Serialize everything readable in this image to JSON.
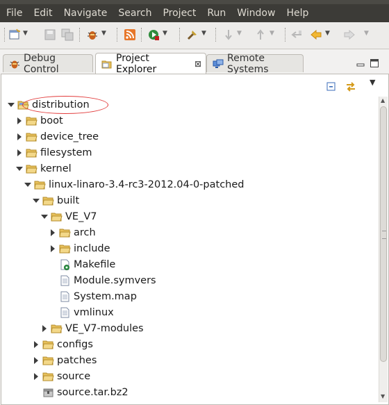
{
  "menu": [
    "File",
    "Edit",
    "Navigate",
    "Search",
    "Project",
    "Run",
    "Window",
    "Help"
  ],
  "toolbar": {
    "icons": [
      "new-icon",
      "save-icon",
      "save-all-icon",
      "debug-icon",
      "rss-icon",
      "run-icon",
      "external-tool-icon",
      "next-edit-icon",
      "previous-edit-icon",
      "last-edit-icon",
      "back-icon",
      "forward-icon"
    ]
  },
  "tabs": [
    {
      "label": "Debug Control",
      "icon": "bug-icon",
      "active": false
    },
    {
      "label": "Project Explorer",
      "icon": "folder-icon",
      "active": true,
      "close": "⊠"
    },
    {
      "label": "Remote Systems",
      "icon": "remote-systems-icon",
      "active": false
    }
  ],
  "tree": [
    {
      "label": "distribution",
      "depth": 0,
      "state": "expanded",
      "type": "project"
    },
    {
      "label": "boot",
      "depth": 1,
      "state": "collapsed",
      "type": "folder"
    },
    {
      "label": "device_tree",
      "depth": 1,
      "state": "collapsed",
      "type": "folder"
    },
    {
      "label": "filesystem",
      "depth": 1,
      "state": "collapsed",
      "type": "folder"
    },
    {
      "label": "kernel",
      "depth": 1,
      "state": "expanded",
      "type": "folder"
    },
    {
      "label": "linux-linaro-3.4-rc3-2012.04-0-patched",
      "depth": 2,
      "state": "expanded",
      "type": "folder"
    },
    {
      "label": "built",
      "depth": 3,
      "state": "expanded",
      "type": "folder"
    },
    {
      "label": "VE_V7",
      "depth": 4,
      "state": "expanded",
      "type": "folder"
    },
    {
      "label": "arch",
      "depth": 5,
      "state": "collapsed",
      "type": "folder"
    },
    {
      "label": "include",
      "depth": 5,
      "state": "collapsed",
      "type": "folder"
    },
    {
      "label": "Makefile",
      "depth": 5,
      "state": "leaf",
      "type": "makefile"
    },
    {
      "label": "Module.symvers",
      "depth": 5,
      "state": "leaf",
      "type": "file"
    },
    {
      "label": "System.map",
      "depth": 5,
      "state": "leaf",
      "type": "file"
    },
    {
      "label": "vmlinux",
      "depth": 5,
      "state": "leaf",
      "type": "file"
    },
    {
      "label": "VE_V7-modules",
      "depth": 4,
      "state": "collapsed",
      "type": "folder"
    },
    {
      "label": "configs",
      "depth": 3,
      "state": "collapsed",
      "type": "folder"
    },
    {
      "label": "patches",
      "depth": 3,
      "state": "collapsed",
      "type": "folder"
    },
    {
      "label": "source",
      "depth": 3,
      "state": "collapsed",
      "type": "folder"
    },
    {
      "label": "source.tar.bz2",
      "depth": 3,
      "state": "leaf",
      "type": "archive"
    }
  ],
  "colors": {
    "menubar": "#3c3b37",
    "folder": "#e8c15c",
    "highlight": "#e23b3b"
  }
}
